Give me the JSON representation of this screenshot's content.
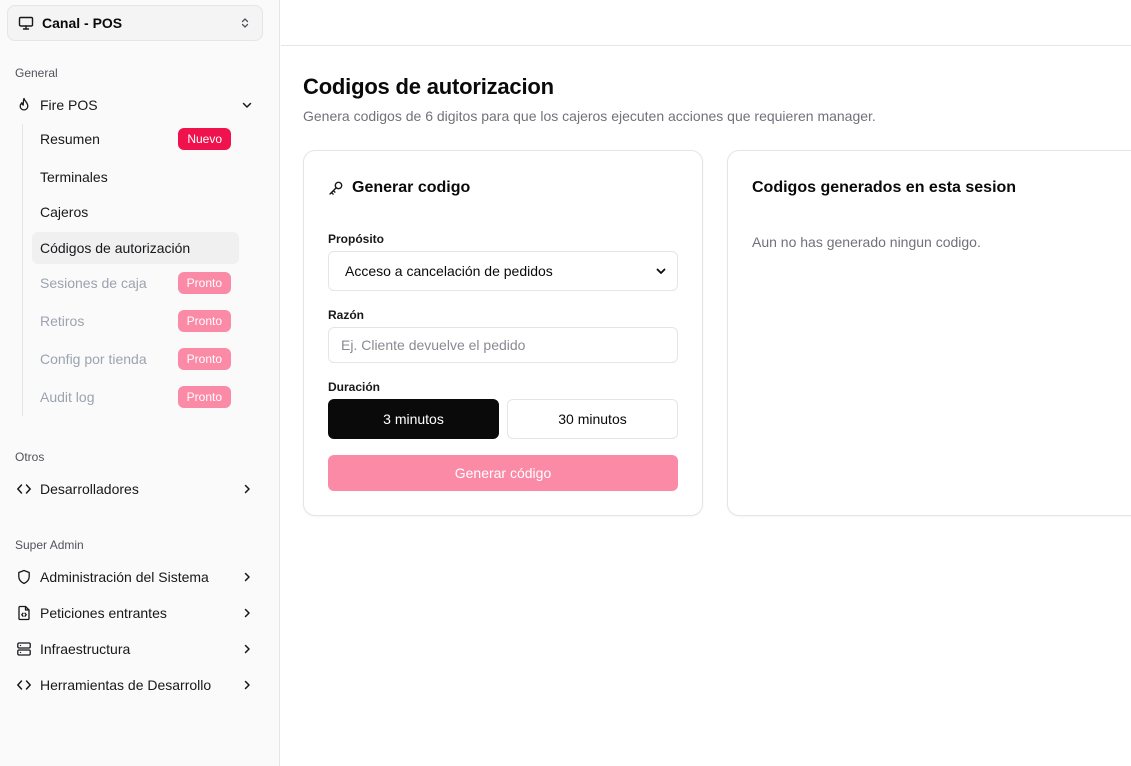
{
  "sidebar": {
    "switcher": {
      "label": "Canal - POS",
      "icon": "monitor-icon"
    },
    "groups": {
      "general": "General",
      "otros": "Otros",
      "super_admin": "Super Admin"
    },
    "fire_pos": {
      "label": "Fire POS",
      "icon": "flame-icon",
      "items": [
        {
          "label": "Resumen",
          "badge": "Nuevo"
        },
        {
          "label": "Terminales"
        },
        {
          "label": "Cajeros"
        },
        {
          "label": "Códigos de autorización"
        },
        {
          "label": "Sesiones de caja",
          "badge": "Pronto"
        },
        {
          "label": "Retiros",
          "badge": "Pronto"
        },
        {
          "label": "Config por tienda",
          "badge": "Pronto"
        },
        {
          "label": "Audit log",
          "badge": "Pronto"
        }
      ]
    },
    "otros_items": [
      {
        "label": "Desarrolladores",
        "icon": "code-icon"
      }
    ],
    "super_admin_items": [
      {
        "label": "Administración del Sistema",
        "icon": "shield-icon"
      },
      {
        "label": "Peticiones entrantes",
        "icon": "file-code-icon"
      },
      {
        "label": "Infraestructura",
        "icon": "server-icon"
      },
      {
        "label": "Herramientas de Desarrollo",
        "icon": "code-icon"
      }
    ]
  },
  "main": {
    "title": "Codigos de autorizacion",
    "subtitle": "Genera codigos de 6 digitos para que los cajeros ejecuten acciones que requieren manager.",
    "generate_card": {
      "title": "Generar codigo",
      "icon": "key-icon",
      "purpose_label": "Propósito",
      "purpose_value": "Acceso a cancelación de pedidos",
      "reason_label": "Razón",
      "reason_placeholder": "Ej. Cliente devuelve el pedido",
      "duration_label": "Duración",
      "duration_options": [
        "3 minutos",
        "30 minutos"
      ],
      "selected_duration": "3 minutos",
      "submit_label": "Generar código"
    },
    "session_card": {
      "title": "Codigos generados en esta sesion",
      "empty": "Aun no has generado ningun codigo."
    }
  },
  "colors": {
    "badge_new": "#f0124d",
    "badge_soon": "#fb8aa6",
    "button_disabled": "#fb8aa6",
    "selected_toggle": "#0a0a0a"
  }
}
